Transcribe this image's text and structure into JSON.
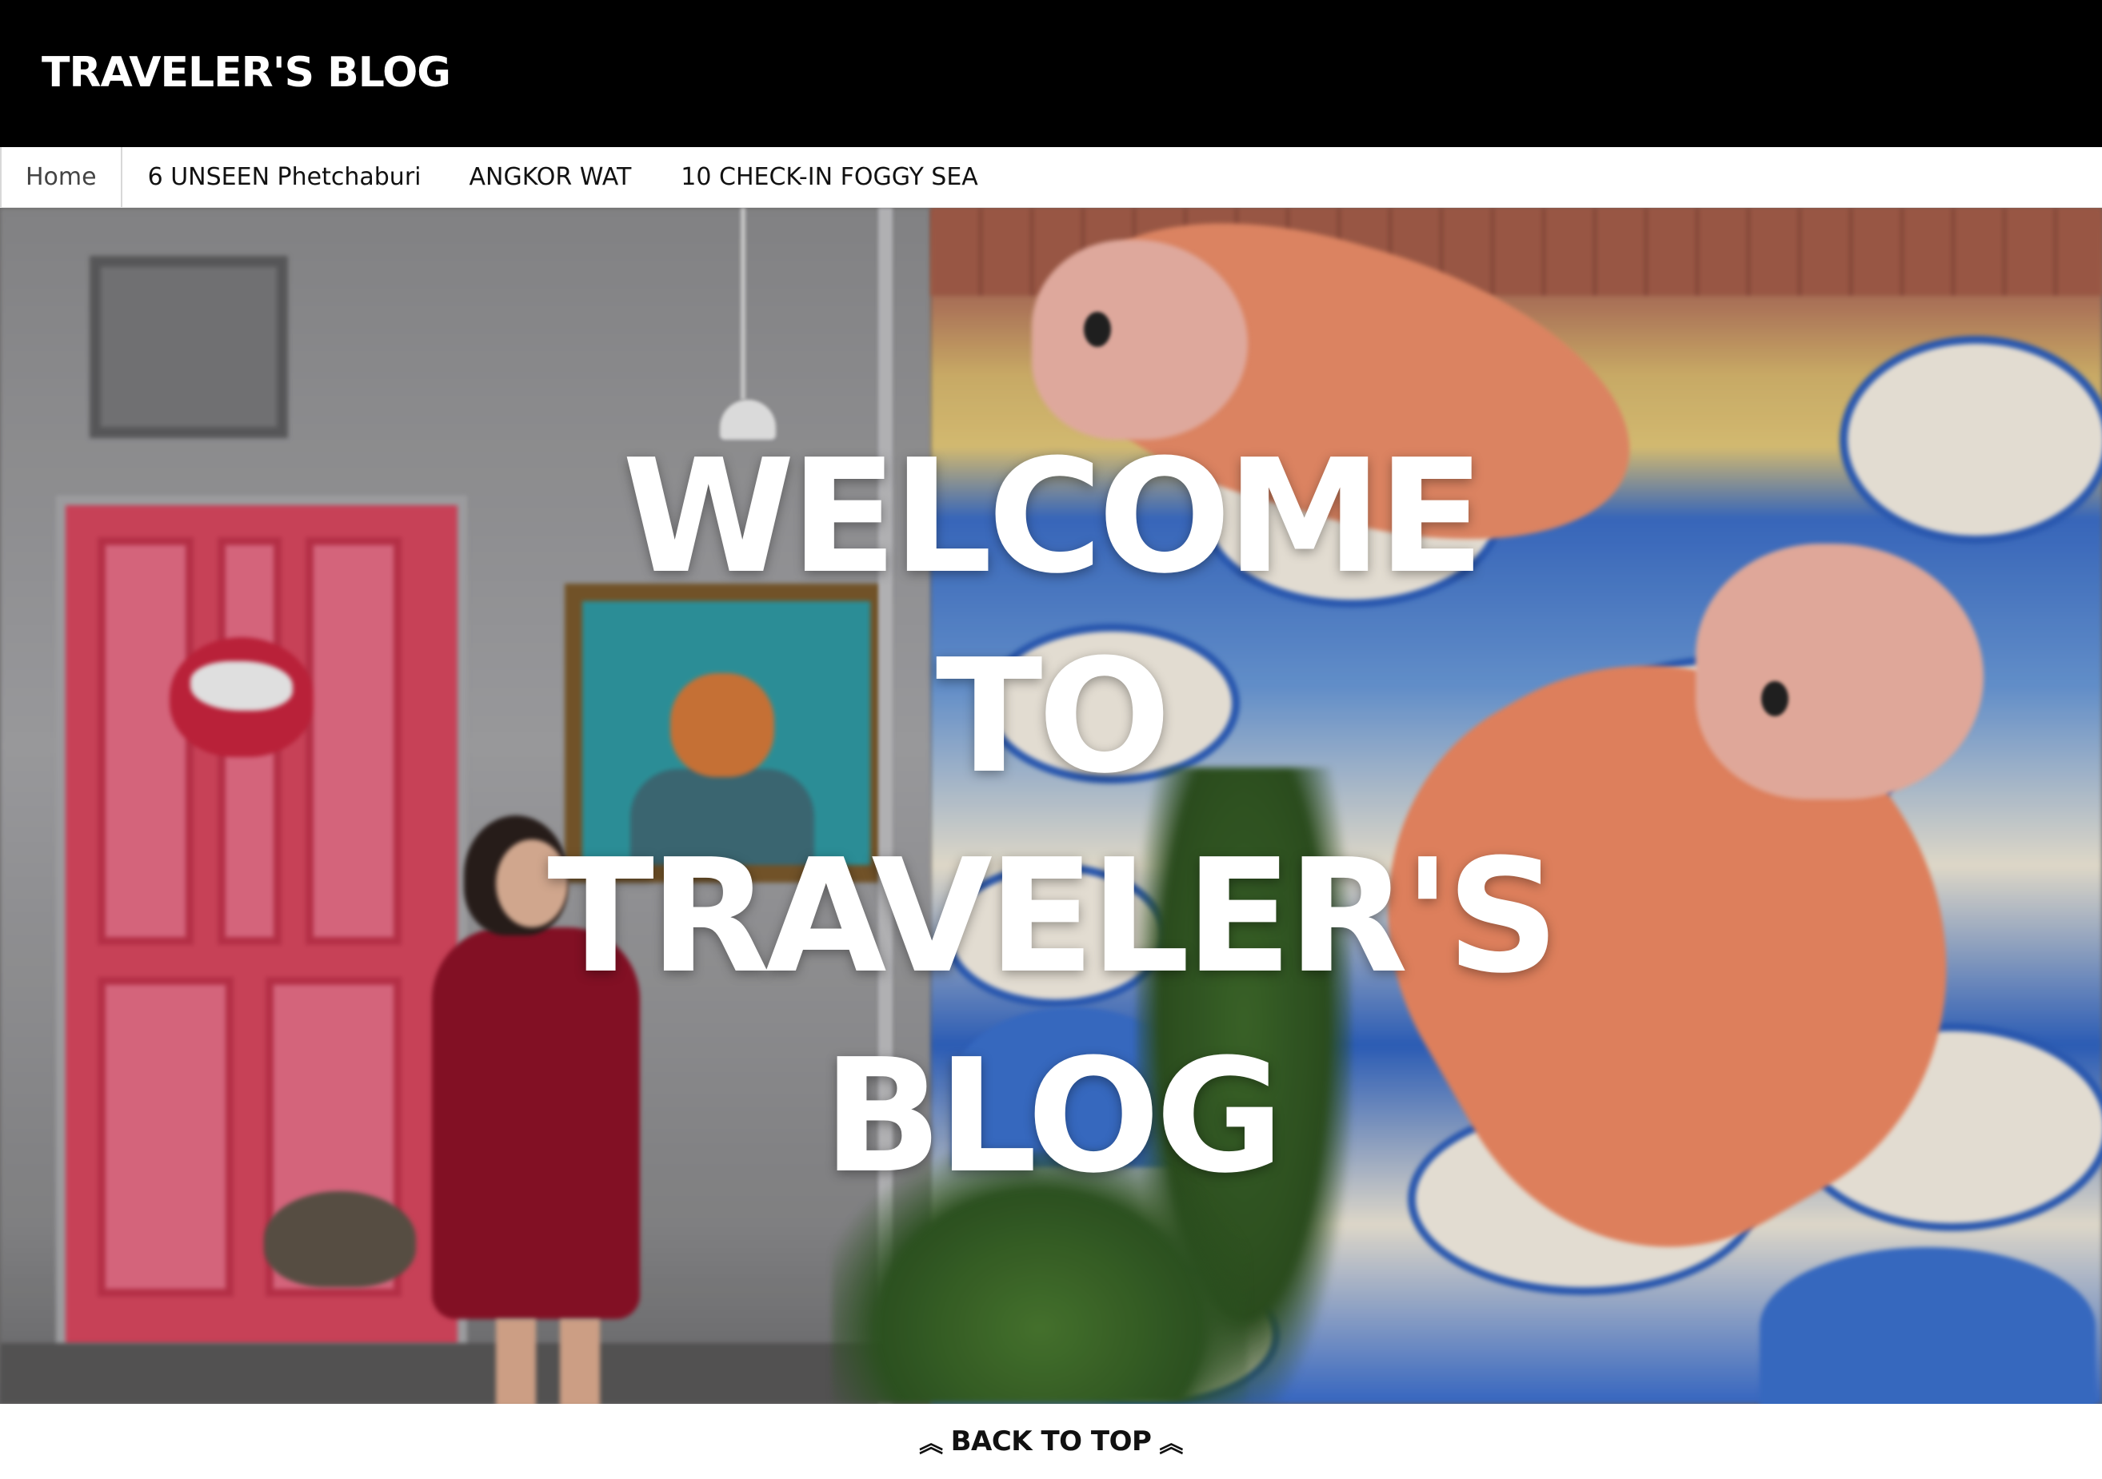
{
  "header": {
    "site_title": "TRAVELER'S BLOG"
  },
  "nav": {
    "items": [
      {
        "label": "Home"
      },
      {
        "label": "6 UNSEEN Phetchaburi"
      },
      {
        "label": "ANGKOR WAT"
      },
      {
        "label": "10 CHECK-IN FOGGY SEA"
      }
    ]
  },
  "hero": {
    "title_lines": [
      "WELCOME",
      "TO",
      "TRAVELER'S",
      "BLOG"
    ],
    "image_subject": "woman in red dress beside pink door and koi fish mural"
  },
  "footer": {
    "back_to_top_label": "BACK TO TOP",
    "back_to_top_icon": "double-chevron-up-icon"
  },
  "colors": {
    "header_bg": "#000000",
    "header_text": "#ffffff",
    "nav_bg": "#ffffff",
    "nav_text": "#111111",
    "hero_text": "#ffffff"
  }
}
